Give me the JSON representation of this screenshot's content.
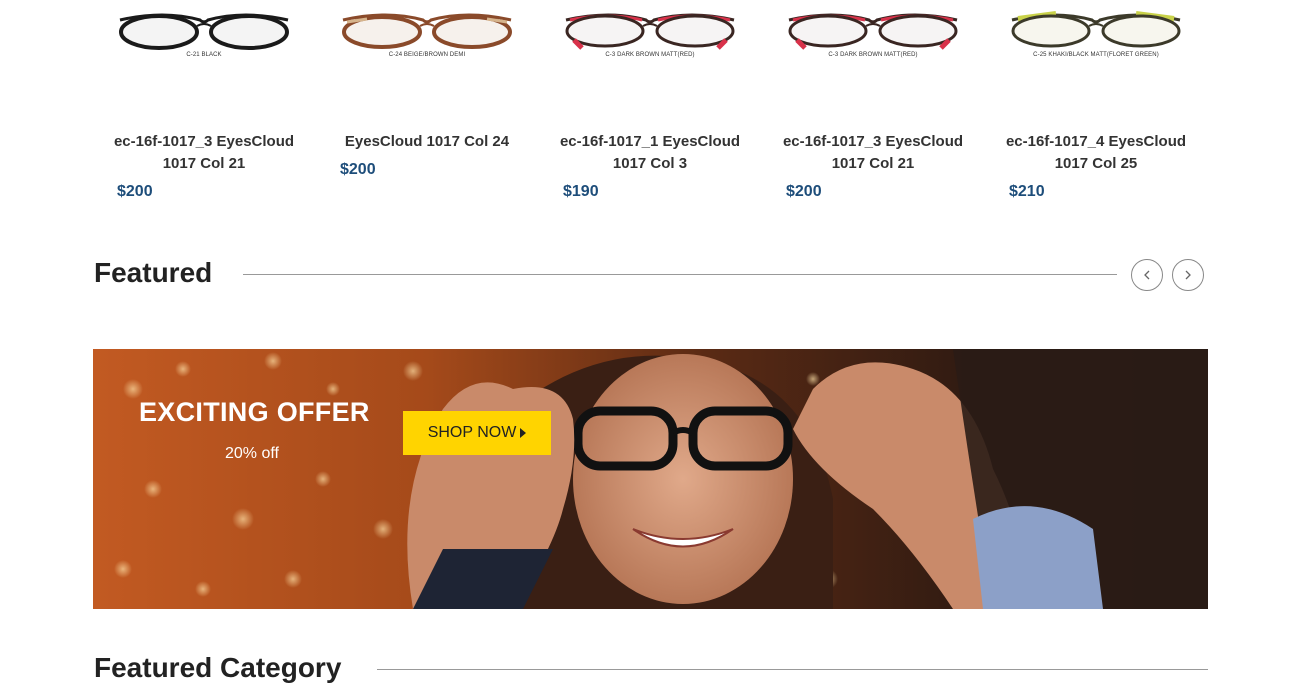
{
  "products": [
    {
      "col_label": "C-21 BLACK",
      "name": "ec-16f-1017_3 EyesCloud 1017 Col 21",
      "price": "$200",
      "frame_color": "#1a1a1a",
      "accent_color": "#1a1a1a"
    },
    {
      "col_label": "C-24 BEIGE/BROWN DEMI",
      "name": "EyesCloud 1017 Col 24",
      "price": "$200",
      "frame_color": "#8a4a2a",
      "accent_color": "#d6b48c"
    },
    {
      "col_label": "C-3 DARK BROWN MATT(RED)",
      "name": "ec-16f-1017_1 EyesCloud 1017 Col 3",
      "price": "$190",
      "frame_color": "#3a2622",
      "accent_color": "#d8324a"
    },
    {
      "col_label": "C-3 DARK BROWN MATT(RED)",
      "name": "ec-16f-1017_3 EyesCloud 1017 Col 21",
      "price": "$200",
      "frame_color": "#3a2622",
      "accent_color": "#d8324a"
    },
    {
      "col_label": "C-25 KHAKI/BLACK MATT(FLORET GREEN)",
      "name": "ec-16f-1017_4 EyesCloud 1017 Col 25",
      "price": "$210",
      "frame_color": "#3c3a2a",
      "accent_color": "#c9d24a"
    }
  ],
  "featured": {
    "title": "Featured",
    "prev_icon": "chevron-left-icon",
    "next_icon": "chevron-right-icon"
  },
  "banner": {
    "title": "EXCITING OFFER",
    "subtitle": "20% off",
    "button_label": "SHOP NOW",
    "button_color": "#ffd400"
  },
  "featured_category": {
    "title": "Featured Category"
  }
}
